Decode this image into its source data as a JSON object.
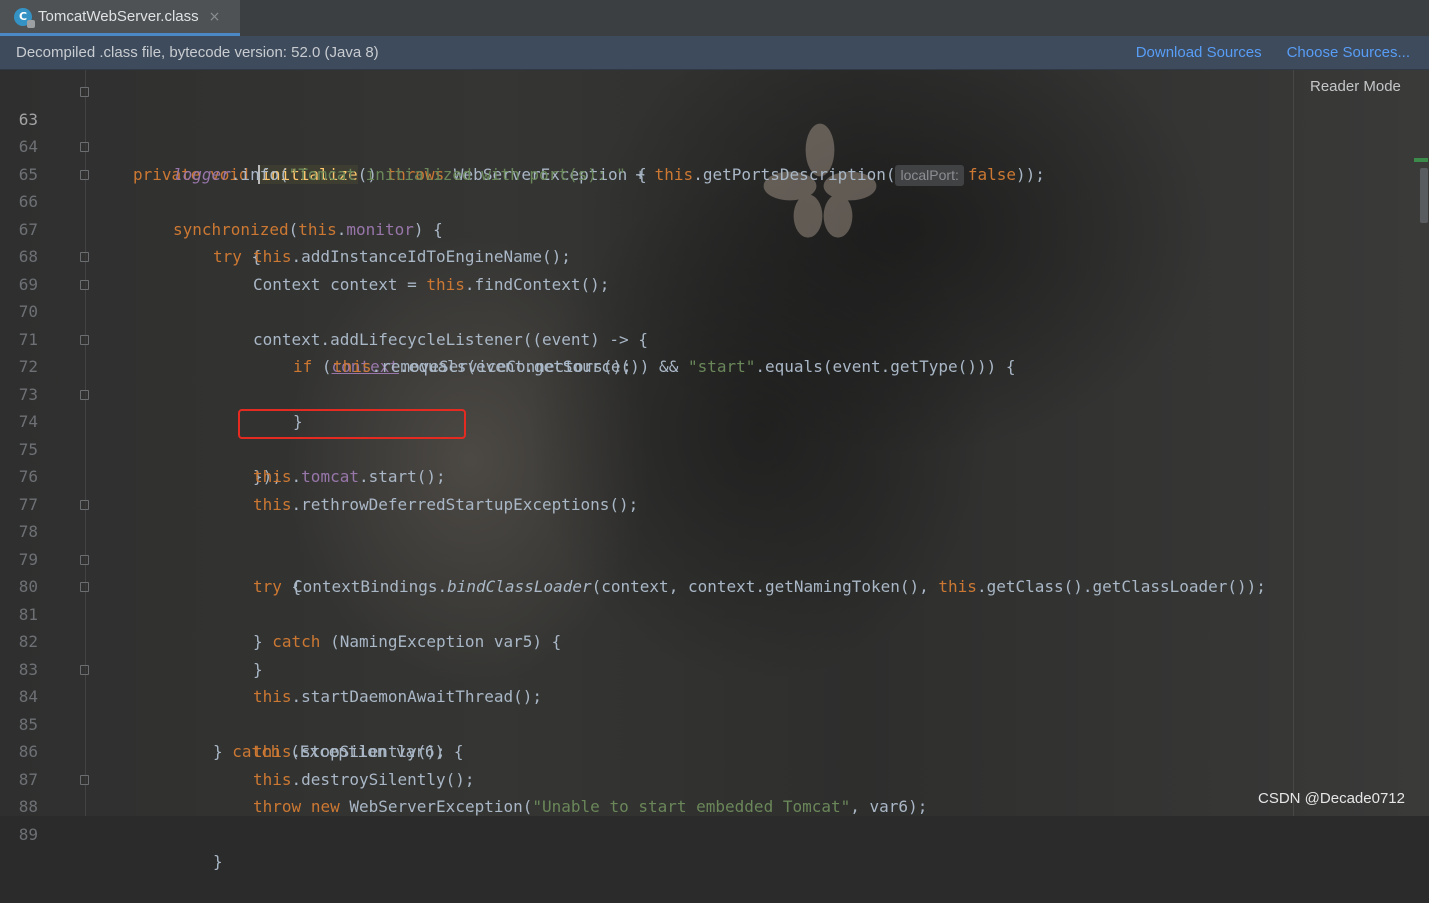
{
  "tab": {
    "label": "TomcatWebServer.class",
    "icon": "class-file-icon",
    "close": "×"
  },
  "banner": {
    "text": "Decompiled .class file, bytecode version: 52.0 (Java 8)",
    "download_sources": "Download Sources",
    "choose_sources": "Choose Sources..."
  },
  "editor": {
    "reader_mode": "Reader Mode"
  },
  "lines": [
    {
      "n": "63"
    },
    {
      "n": "64"
    },
    {
      "n": "65"
    },
    {
      "n": "66"
    },
    {
      "n": "67"
    },
    {
      "n": "68"
    },
    {
      "n": "69"
    },
    {
      "n": "70"
    },
    {
      "n": "71"
    },
    {
      "n": "72"
    },
    {
      "n": "73"
    },
    {
      "n": "74"
    },
    {
      "n": "75"
    },
    {
      "n": "76"
    },
    {
      "n": "77"
    },
    {
      "n": "78"
    },
    {
      "n": "79"
    },
    {
      "n": "80"
    },
    {
      "n": "81"
    },
    {
      "n": "82"
    },
    {
      "n": "83"
    },
    {
      "n": "84"
    },
    {
      "n": "85"
    },
    {
      "n": "86"
    },
    {
      "n": "87"
    },
    {
      "n": "88"
    },
    {
      "n": "89"
    }
  ],
  "code": {
    "l63": {
      "kw1": "private",
      "kw2": "void",
      "method": "initialize",
      "p": "() ",
      "kw3": "throws",
      "rest": " WebServerException {"
    },
    "l64": {
      "logger": "logger",
      "a": ".info(",
      "str": "\"Tomcat initialized with port(s): \"",
      "b": " + ",
      "this": "this",
      "c": ".getPortsDescription(",
      "hint": "localPort:",
      "false": "false",
      "d": "));"
    },
    "l65": {
      "kw": "synchronized",
      "a": "(",
      "this": "this",
      "dot": ".",
      "monitor": "monitor",
      "b": ") {"
    },
    "l66": {
      "kw": "try",
      "rest": " {"
    },
    "l67": {
      "this": "this",
      "rest": ".addInstanceIdToEngineName();"
    },
    "l68": {
      "a": "Context context = ",
      "this": "this",
      "rest": ".findContext();"
    },
    "l69": {
      "text": "context.addLifecycleListener((event) -> {"
    },
    "l70": {
      "kw": "if",
      "a": " (",
      "ctx": "context",
      "b": ".equals(event.getSource()) && ",
      "str": "\"start\"",
      "c": ".equals(event.getType())) {"
    },
    "l71": {
      "this": "this",
      "rest": ".removeServiceConnectors();"
    },
    "l72": {
      "text": "}"
    },
    "l74": {
      "text": "});"
    },
    "l75": {
      "this": "this",
      "dot": ".",
      "tomcat": "tomcat",
      "rest": ".start();"
    },
    "l76": {
      "this": "this",
      "rest": ".rethrowDeferredStartupExceptions();"
    },
    "l78": {
      "kw": "try",
      "rest": " {"
    },
    "l79": {
      "a": "ContextBindings.",
      "m": "bindClassLoader",
      "b": "(context, context.getNamingToken(), ",
      "this": "this",
      "c": ".getClass().getClassLoader());"
    },
    "l80": {
      "a": "} ",
      "kw": "catch",
      "b": " (NamingException var5) {"
    },
    "l81": {
      "text": "}"
    },
    "l83": {
      "this": "this",
      "rest": ".startDaemonAwaitThread();"
    },
    "l84": {
      "a": "} ",
      "kw": "catch",
      "b": " (Exception var6) {"
    },
    "l85": {
      "this": "this",
      "rest": ".stopSilently();"
    },
    "l86": {
      "this": "this",
      "rest": ".destroySilently();"
    },
    "l87": {
      "kw1": "throw",
      "kw2": "new",
      "a": " WebServerException(",
      "str": "\"Unable to start embedded Tomcat\"",
      "b": ", var6);"
    },
    "l88": {
      "text": "}"
    }
  },
  "watermark": "CSDN @Decade0712",
  "colors": {
    "keyword": "#cc7832",
    "field": "#9876aa",
    "string": "#6a8759",
    "method": "#ffc66d",
    "text": "#a9b7c6",
    "highlight": "#e52a22",
    "link": "#589df6"
  }
}
